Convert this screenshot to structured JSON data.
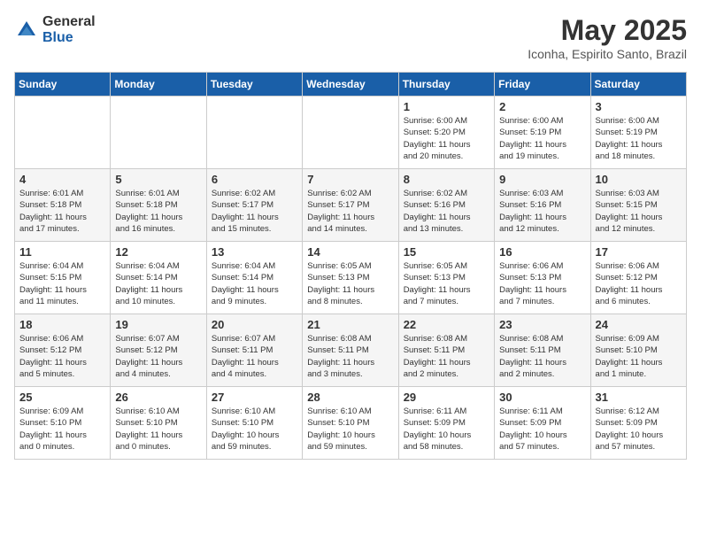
{
  "logo": {
    "general": "General",
    "blue": "Blue"
  },
  "title": "May 2025",
  "subtitle": "Iconha, Espirito Santo, Brazil",
  "headers": [
    "Sunday",
    "Monday",
    "Tuesday",
    "Wednesday",
    "Thursday",
    "Friday",
    "Saturday"
  ],
  "weeks": [
    [
      {
        "day": "",
        "info": ""
      },
      {
        "day": "",
        "info": ""
      },
      {
        "day": "",
        "info": ""
      },
      {
        "day": "",
        "info": ""
      },
      {
        "day": "1",
        "info": "Sunrise: 6:00 AM\nSunset: 5:20 PM\nDaylight: 11 hours\nand 20 minutes."
      },
      {
        "day": "2",
        "info": "Sunrise: 6:00 AM\nSunset: 5:19 PM\nDaylight: 11 hours\nand 19 minutes."
      },
      {
        "day": "3",
        "info": "Sunrise: 6:00 AM\nSunset: 5:19 PM\nDaylight: 11 hours\nand 18 minutes."
      }
    ],
    [
      {
        "day": "4",
        "info": "Sunrise: 6:01 AM\nSunset: 5:18 PM\nDaylight: 11 hours\nand 17 minutes."
      },
      {
        "day": "5",
        "info": "Sunrise: 6:01 AM\nSunset: 5:18 PM\nDaylight: 11 hours\nand 16 minutes."
      },
      {
        "day": "6",
        "info": "Sunrise: 6:02 AM\nSunset: 5:17 PM\nDaylight: 11 hours\nand 15 minutes."
      },
      {
        "day": "7",
        "info": "Sunrise: 6:02 AM\nSunset: 5:17 PM\nDaylight: 11 hours\nand 14 minutes."
      },
      {
        "day": "8",
        "info": "Sunrise: 6:02 AM\nSunset: 5:16 PM\nDaylight: 11 hours\nand 13 minutes."
      },
      {
        "day": "9",
        "info": "Sunrise: 6:03 AM\nSunset: 5:16 PM\nDaylight: 11 hours\nand 12 minutes."
      },
      {
        "day": "10",
        "info": "Sunrise: 6:03 AM\nSunset: 5:15 PM\nDaylight: 11 hours\nand 12 minutes."
      }
    ],
    [
      {
        "day": "11",
        "info": "Sunrise: 6:04 AM\nSunset: 5:15 PM\nDaylight: 11 hours\nand 11 minutes."
      },
      {
        "day": "12",
        "info": "Sunrise: 6:04 AM\nSunset: 5:14 PM\nDaylight: 11 hours\nand 10 minutes."
      },
      {
        "day": "13",
        "info": "Sunrise: 6:04 AM\nSunset: 5:14 PM\nDaylight: 11 hours\nand 9 minutes."
      },
      {
        "day": "14",
        "info": "Sunrise: 6:05 AM\nSunset: 5:13 PM\nDaylight: 11 hours\nand 8 minutes."
      },
      {
        "day": "15",
        "info": "Sunrise: 6:05 AM\nSunset: 5:13 PM\nDaylight: 11 hours\nand 7 minutes."
      },
      {
        "day": "16",
        "info": "Sunrise: 6:06 AM\nSunset: 5:13 PM\nDaylight: 11 hours\nand 7 minutes."
      },
      {
        "day": "17",
        "info": "Sunrise: 6:06 AM\nSunset: 5:12 PM\nDaylight: 11 hours\nand 6 minutes."
      }
    ],
    [
      {
        "day": "18",
        "info": "Sunrise: 6:06 AM\nSunset: 5:12 PM\nDaylight: 11 hours\nand 5 minutes."
      },
      {
        "day": "19",
        "info": "Sunrise: 6:07 AM\nSunset: 5:12 PM\nDaylight: 11 hours\nand 4 minutes."
      },
      {
        "day": "20",
        "info": "Sunrise: 6:07 AM\nSunset: 5:11 PM\nDaylight: 11 hours\nand 4 minutes."
      },
      {
        "day": "21",
        "info": "Sunrise: 6:08 AM\nSunset: 5:11 PM\nDaylight: 11 hours\nand 3 minutes."
      },
      {
        "day": "22",
        "info": "Sunrise: 6:08 AM\nSunset: 5:11 PM\nDaylight: 11 hours\nand 2 minutes."
      },
      {
        "day": "23",
        "info": "Sunrise: 6:08 AM\nSunset: 5:11 PM\nDaylight: 11 hours\nand 2 minutes."
      },
      {
        "day": "24",
        "info": "Sunrise: 6:09 AM\nSunset: 5:10 PM\nDaylight: 11 hours\nand 1 minute."
      }
    ],
    [
      {
        "day": "25",
        "info": "Sunrise: 6:09 AM\nSunset: 5:10 PM\nDaylight: 11 hours\nand 0 minutes."
      },
      {
        "day": "26",
        "info": "Sunrise: 6:10 AM\nSunset: 5:10 PM\nDaylight: 11 hours\nand 0 minutes."
      },
      {
        "day": "27",
        "info": "Sunrise: 6:10 AM\nSunset: 5:10 PM\nDaylight: 10 hours\nand 59 minutes."
      },
      {
        "day": "28",
        "info": "Sunrise: 6:10 AM\nSunset: 5:10 PM\nDaylight: 10 hours\nand 59 minutes."
      },
      {
        "day": "29",
        "info": "Sunrise: 6:11 AM\nSunset: 5:09 PM\nDaylight: 10 hours\nand 58 minutes."
      },
      {
        "day": "30",
        "info": "Sunrise: 6:11 AM\nSunset: 5:09 PM\nDaylight: 10 hours\nand 57 minutes."
      },
      {
        "day": "31",
        "info": "Sunrise: 6:12 AM\nSunset: 5:09 PM\nDaylight: 10 hours\nand 57 minutes."
      }
    ]
  ]
}
